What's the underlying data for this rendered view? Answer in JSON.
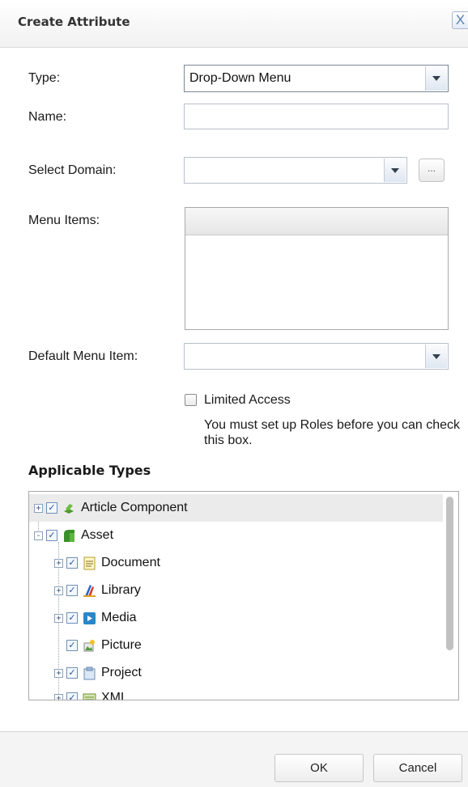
{
  "dialog": {
    "title": "Create Attribute",
    "close_glyph": "X"
  },
  "form": {
    "type_label": "Type:",
    "type_value": "Drop-Down Menu",
    "name_label": "Name:",
    "name_value": "",
    "domain_label": "Select Domain:",
    "domain_value": "",
    "domain_button_label": "...",
    "menu_items_label": "Menu Items:",
    "default_item_label": "Default Menu Item:",
    "default_item_value": "",
    "limited_access_label": "Limited Access",
    "limited_access_checked": false,
    "limited_access_help": "You must set up Roles before you can check this box."
  },
  "applicable_types": {
    "heading": "Applicable Types",
    "items": [
      {
        "label": "Article Component",
        "icon": "article-component-icon",
        "checked": true,
        "expander": "+"
      },
      {
        "label": "Asset",
        "icon": "asset-icon",
        "checked": true,
        "expander": "-"
      },
      {
        "label": "Document",
        "icon": "document-icon",
        "checked": true,
        "expander": "+"
      },
      {
        "label": "Library",
        "icon": "library-icon",
        "checked": true,
        "expander": "+"
      },
      {
        "label": "Media",
        "icon": "media-icon",
        "checked": true,
        "expander": "+"
      },
      {
        "label": "Picture",
        "icon": "picture-icon",
        "checked": true,
        "expander": ""
      },
      {
        "label": "Project",
        "icon": "project-icon",
        "checked": true,
        "expander": "+"
      },
      {
        "label": "XML",
        "icon": "xml-icon",
        "checked": true,
        "expander": "+"
      }
    ]
  },
  "footer": {
    "ok_label": "OK",
    "cancel_label": "Cancel"
  },
  "colors": {
    "accent": "#5a7fb0",
    "checkbox_tick": "#2456a6",
    "border": "#b7c0ca"
  }
}
